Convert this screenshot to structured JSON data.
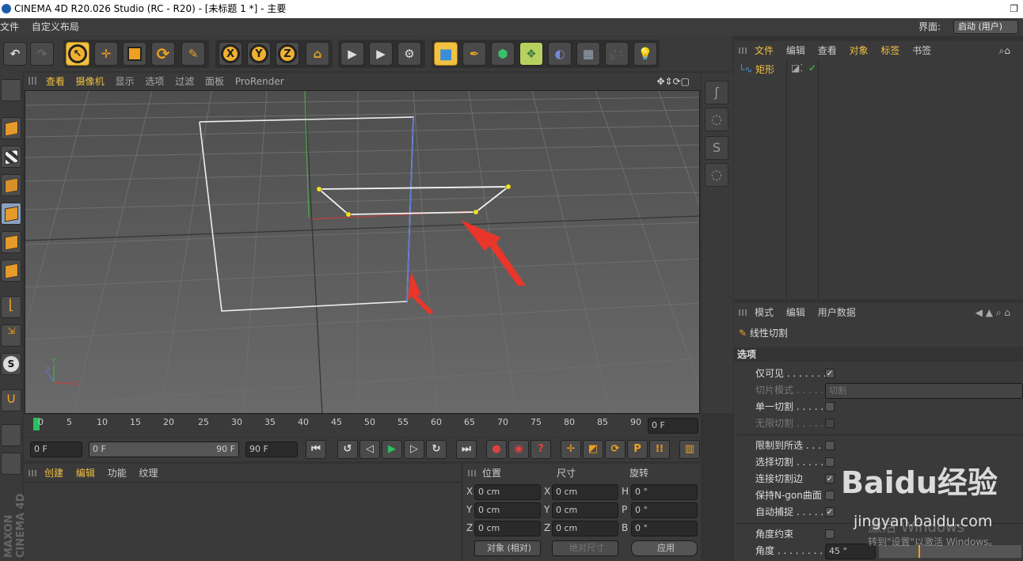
{
  "titlebar": {
    "title": "CINEMA 4D R20.026 Studio (RC - R20) - [未标题 1 *] - 主要"
  },
  "menubar": {
    "items": [
      "文件",
      "自定义布局"
    ],
    "layout_label": "界面:",
    "layout_value": "启动 (用户)"
  },
  "viewport": {
    "menu": [
      "查看",
      "摄像机",
      "显示",
      "选项",
      "过滤",
      "面板",
      "ProRender"
    ],
    "axis_labels": {
      "x": "X",
      "y": "Y",
      "z": "Z"
    }
  },
  "timeline": {
    "ticks": [
      "0",
      "5",
      "10",
      "15",
      "20",
      "25",
      "30",
      "35",
      "40",
      "45",
      "50",
      "55",
      "60",
      "65",
      "70",
      "75",
      "80",
      "85",
      "90"
    ],
    "current_frame": "0 F"
  },
  "transport": {
    "start": "0 F",
    "range_start": "0 F",
    "range_end": "90 F",
    "end": "90 F"
  },
  "material_panel": {
    "tabs": [
      "创建",
      "编辑",
      "功能",
      "纹理"
    ]
  },
  "coordinates": {
    "headers": [
      "位置",
      "尺寸",
      "旋转"
    ],
    "rows": [
      {
        "axis": "X",
        "pos": "0 cm",
        "size_axis": "X",
        "size": "0 cm",
        "rot_axis": "H",
        "rot": "0 °"
      },
      {
        "axis": "Y",
        "pos": "0 cm",
        "size_axis": "Y",
        "size": "0 cm",
        "rot_axis": "P",
        "rot": "0 °"
      },
      {
        "axis": "Z",
        "pos": "0 cm",
        "size_axis": "Z",
        "size": "0 cm",
        "rot_axis": "B",
        "rot": "0 °"
      }
    ],
    "mode": "对象 (相对)",
    "size_mode": "绝对尺寸",
    "apply": "应用"
  },
  "object_manager": {
    "menu": [
      "文件",
      "编辑",
      "查看",
      "对象",
      "标签",
      "书签"
    ],
    "objects": [
      {
        "name": "矩形"
      }
    ]
  },
  "attribute_manager": {
    "menu": [
      "模式",
      "编辑",
      "用户数据"
    ],
    "tool_name": "线性切割",
    "section": "选项",
    "options": [
      {
        "label": "仅可见 . . . . . . . .",
        "checked": true,
        "enabled": true
      },
      {
        "label": "切片模式 . . . . .",
        "value": "切割",
        "enabled": false
      },
      {
        "label": "单一切割 . . . . . .",
        "checked": false,
        "enabled": true
      },
      {
        "label": "无限切割 . . . . . .",
        "checked": false,
        "enabled": false
      },
      {
        "label": "限制到所选 . . . .",
        "checked": false,
        "enabled": true
      },
      {
        "label": "选择切割 . . . . . .",
        "checked": false,
        "enabled": true
      },
      {
        "label": "连接切割边",
        "checked": true,
        "enabled": true
      },
      {
        "label": "保持N-gon曲面",
        "checked": false,
        "enabled": true
      },
      {
        "label": "自动捕捉 . . . . . .",
        "checked": true,
        "enabled": true
      },
      {
        "label": "角度约束",
        "checked": false,
        "enabled": true
      },
      {
        "label": "角度 . . . . . . . . . .",
        "value": "45 °",
        "enabled": true
      }
    ]
  },
  "watermark": {
    "brand": "Baidu经验",
    "url": "jingyan.baidu.com",
    "activate_line1": "激活 Windows",
    "activate_line2": "转到\"设置\"以激活 Windows。"
  },
  "colors": {
    "accent": "#f0c040",
    "bg": "#3a3a3a",
    "viewport": "#5c5c5c",
    "arrow": "#e8362a"
  }
}
